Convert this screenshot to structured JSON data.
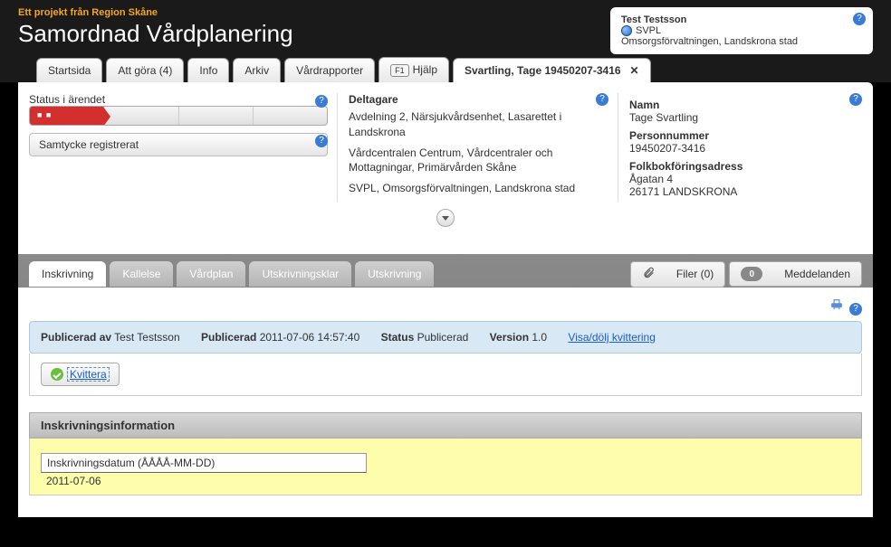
{
  "header": {
    "subtitle": "Ett projekt från Region Skåne",
    "title": "Samordnad Vårdplanering"
  },
  "user": {
    "name": "Test Testsson",
    "role": "SVPL",
    "org": "Omsorgsförvaltningen, Landskrona stad"
  },
  "tabs": {
    "start": "Startsida",
    "todo": "Att göra (4)",
    "info": "Info",
    "archive": "Arkiv",
    "reports": "Vårdrapporter",
    "help_key": "F1",
    "help": "Hjälp",
    "patient": "Svartling, Tage 19450207-3416",
    "close": "✕"
  },
  "status": {
    "label": "Status i ärendet",
    "consent": "Samtycke registrerat"
  },
  "participants": {
    "label": "Deltagare",
    "p1": "Avdelning 2, Närsjukvårdsenhet, Lasarettet i Landskrona",
    "p2": "Vårdcentralen Centrum, Vårdcentraler och Mottagningar, Primärvården Skåne",
    "p3": "SVPL, Omsorgsförvaltningen, Landskrona stad"
  },
  "person": {
    "name_label": "Namn",
    "name": "Tage Svartling",
    "pnr_label": "Personnummer",
    "pnr": "19450207-3416",
    "addr_label": "Folkbokföringsadress",
    "addr1": "Ågatan 4",
    "addr2": "26171 LANDSKRONA"
  },
  "subtabs": {
    "inskrivning": "Inskrivning",
    "kallelse": "Kallelse",
    "vardplan": "Vårdplan",
    "utskrivningsklar": "Utskrivningsklar",
    "utskrivning": "Utskrivning",
    "filer": "Filer (0)",
    "msg_count": "0",
    "meddelanden": "Meddelanden"
  },
  "infobar": {
    "pub_by_label": "Publicerad av",
    "pub_by": "Test Testsson",
    "pub_label": "Publicerad",
    "pub_date": "2011-07-06 14:57:40",
    "status_label": "Status",
    "status": "Publicerad",
    "version_label": "Version",
    "version": "1.0",
    "link": "Visa/dölj kvittering"
  },
  "kvittera": "Kvittera",
  "section": {
    "title": "Inskrivningsinformation",
    "field_label": "Inskrivningsdatum (ÅÅÅÅ-MM-DD)",
    "field_value": "2011-07-06"
  }
}
